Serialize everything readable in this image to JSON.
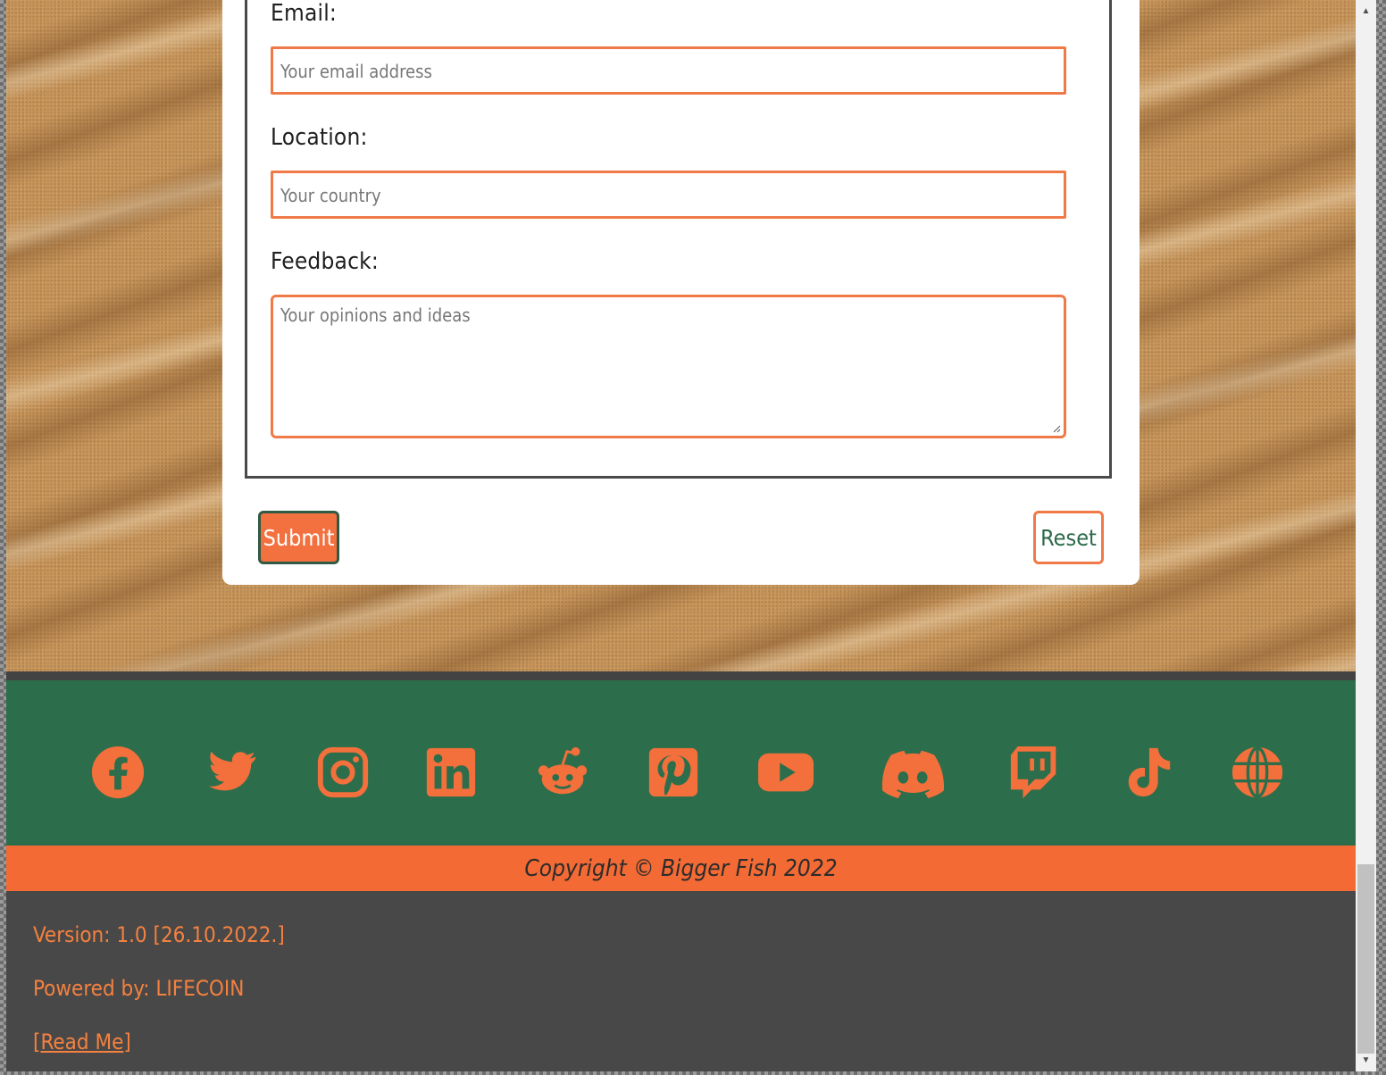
{
  "form": {
    "email": {
      "label": "Email:",
      "placeholder": "Your email address"
    },
    "location": {
      "label": "Location:",
      "placeholder": "Your country"
    },
    "feedback": {
      "label": "Feedback:",
      "placeholder": "Your opinions and ideas"
    },
    "submit_label": "Submit",
    "reset_label": "Reset"
  },
  "social": [
    {
      "name": "facebook-icon"
    },
    {
      "name": "twitter-icon"
    },
    {
      "name": "instagram-icon"
    },
    {
      "name": "linkedin-icon"
    },
    {
      "name": "reddit-icon"
    },
    {
      "name": "pinterest-icon"
    },
    {
      "name": "youtube-icon"
    },
    {
      "name": "discord-icon"
    },
    {
      "name": "twitch-icon"
    },
    {
      "name": "tiktok-icon"
    },
    {
      "name": "globe-icon"
    }
  ],
  "footer": {
    "copyright": "Copyright © Bigger Fish 2022",
    "version": "Version: 1.0 [26.10.2022.]",
    "powered_by": "Powered by: LIFECOIN",
    "readme_open": "[",
    "readme_link": "Read Me",
    "readme_close": "]"
  },
  "colors": {
    "accent": "#f36f3b",
    "green": "#2c6e4b",
    "dark": "#484848"
  }
}
